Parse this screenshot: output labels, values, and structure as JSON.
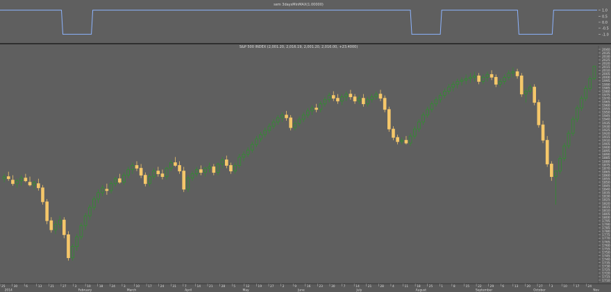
{
  "colors": {
    "background": "#5f5f5f",
    "up_candle_border": "#2f8f2f",
    "up_candle_fill": "#5f5f5f",
    "down_candle": "#f5c76a",
    "ind_line": "#8db4ff",
    "separator": "#1f1f1f",
    "axis_text": "#dcdcdc"
  },
  "chart_data": [
    {
      "type": "line",
      "title": "sem 3daysMinMAX(1.00000)",
      "ylim": [
        -1.5,
        1.5
      ],
      "y_ticks": [
        "1.0",
        "0.5",
        "0.0",
        "-0.5",
        "-1.0"
      ],
      "y_tick_values": [
        1.0,
        0.5,
        0.0,
        -0.5,
        -1.0
      ],
      "segments": [
        {
          "from": 0,
          "to": 0.105,
          "value": 1
        },
        {
          "from": 0.105,
          "to": 0.155,
          "value": -1
        },
        {
          "from": 0.155,
          "to": 0.688,
          "value": 1
        },
        {
          "from": 0.688,
          "to": 0.738,
          "value": -1
        },
        {
          "from": 0.738,
          "to": 0.867,
          "value": 1
        },
        {
          "from": 0.867,
          "to": 0.925,
          "value": -1
        },
        {
          "from": 0.925,
          "to": 1.0,
          "value": 1
        },
        {
          "from": 0.963,
          "to": 1.0,
          "value": -1
        }
      ]
    },
    {
      "type": "candlestick",
      "title": "S&P 500 INDEX (2,001.20, 2,016.19, 2,001.20, 2,016.00, +23.4000)",
      "ylim": [
        1705,
        2045
      ],
      "y_ticks": [
        "2040",
        "2035",
        "2030",
        "2025",
        "2020",
        "2015",
        "2010",
        "2005",
        "2000",
        "1995",
        "1990",
        "1985",
        "1980",
        "1975",
        "1970",
        "1965",
        "1960",
        "1955",
        "1950",
        "1945",
        "1940",
        "1935",
        "1930",
        "1925",
        "1920",
        "1915",
        "1910",
        "1905",
        "1900",
        "1895",
        "1890",
        "1885",
        "1880",
        "1875",
        "1870",
        "1865",
        "1860",
        "1855",
        "1850",
        "1845",
        "1840",
        "1835",
        "1830",
        "1825",
        "1820",
        "1815",
        "1810",
        "1805",
        "1800",
        "1795",
        "1790",
        "1785",
        "1780",
        "1775",
        "1770",
        "1765",
        "1760",
        "1755",
        "1750",
        "1745",
        "1740",
        "1735",
        "1730",
        "1725",
        "1720",
        "1715",
        "1710"
      ],
      "x_ticks": [
        "25",
        "30",
        "6",
        "13",
        "21",
        "27",
        "3",
        "10",
        "18",
        "24",
        "3",
        "10",
        "17",
        "24",
        "31",
        "7",
        "14",
        "21",
        "28",
        "5",
        "12",
        "19",
        "27",
        "2",
        "9",
        "16",
        "23",
        "30",
        "7",
        "14",
        "21",
        "28",
        "4",
        "11",
        "18",
        "25",
        "1",
        "8",
        "15",
        "22",
        "29",
        "6",
        "13",
        "20",
        "27",
        "3",
        "10",
        "17",
        "24"
      ],
      "month_labels": [
        {
          "label": "2014",
          "slot": 0.7
        },
        {
          "label": "February",
          "slot": 11.9
        },
        {
          "label": "March",
          "slot": 19.3
        },
        {
          "label": "April",
          "slot": 28.1
        },
        {
          "label": "May",
          "slot": 36.9
        },
        {
          "label": "June",
          "slot": 45.3
        },
        {
          "label": "July",
          "slot": 54.2
        },
        {
          "label": "August",
          "slot": 63.2
        },
        {
          "label": "September",
          "slot": 72.3
        },
        {
          "label": "October",
          "slot": 81.1
        },
        {
          "label": "Nov",
          "slot": 90.2
        }
      ],
      "ohlc": [
        [
          1855,
          1862,
          1850,
          1858
        ],
        [
          1858,
          1865,
          1852,
          1855
        ],
        [
          1853,
          1860,
          1845,
          1848
        ],
        [
          1848,
          1855,
          1842,
          1852
        ],
        [
          1852,
          1860,
          1845,
          1856
        ],
        [
          1856,
          1862,
          1850,
          1852
        ],
        [
          1850,
          1858,
          1844,
          1846
        ],
        [
          1846,
          1852,
          1840,
          1850
        ],
        [
          1848,
          1855,
          1838,
          1842
        ],
        [
          1842,
          1846,
          1818,
          1822
        ],
        [
          1822,
          1826,
          1790,
          1795
        ],
        [
          1795,
          1800,
          1778,
          1782
        ],
        [
          1782,
          1795,
          1776,
          1790
        ],
        [
          1790,
          1802,
          1784,
          1796
        ],
        [
          1796,
          1800,
          1770,
          1775
        ],
        [
          1775,
          1780,
          1738,
          1742
        ],
        [
          1742,
          1762,
          1738,
          1758
        ],
        [
          1758,
          1776,
          1752,
          1772
        ],
        [
          1772,
          1792,
          1768,
          1788
        ],
        [
          1788,
          1806,
          1782,
          1802
        ],
        [
          1802,
          1818,
          1796,
          1814
        ],
        [
          1814,
          1830,
          1810,
          1826
        ],
        [
          1826,
          1840,
          1820,
          1835
        ],
        [
          1835,
          1846,
          1830,
          1842
        ],
        [
          1840,
          1848,
          1832,
          1838
        ],
        [
          1838,
          1852,
          1834,
          1848
        ],
        [
          1848,
          1858,
          1844,
          1855
        ],
        [
          1855,
          1862,
          1848,
          1850
        ],
        [
          1850,
          1864,
          1846,
          1860
        ],
        [
          1860,
          1872,
          1856,
          1868
        ],
        [
          1868,
          1878,
          1862,
          1874
        ],
        [
          1874,
          1880,
          1866,
          1870
        ],
        [
          1870,
          1876,
          1856,
          1860
        ],
        [
          1860,
          1864,
          1844,
          1848
        ],
        [
          1848,
          1862,
          1844,
          1858
        ],
        [
          1858,
          1870,
          1854,
          1866
        ],
        [
          1866,
          1872,
          1858,
          1862
        ],
        [
          1862,
          1868,
          1854,
          1858
        ],
        [
          1858,
          1872,
          1854,
          1870
        ],
        [
          1870,
          1882,
          1866,
          1878
        ],
        [
          1878,
          1886,
          1872,
          1874
        ],
        [
          1874,
          1880,
          1862,
          1866
        ],
        [
          1866,
          1872,
          1836,
          1840
        ],
        [
          1840,
          1860,
          1836,
          1856
        ],
        [
          1856,
          1866,
          1852,
          1862
        ],
        [
          1862,
          1872,
          1858,
          1868
        ],
        [
          1868,
          1874,
          1860,
          1864
        ],
        [
          1864,
          1872,
          1858,
          1870
        ],
        [
          1870,
          1878,
          1864,
          1872
        ],
        [
          1872,
          1876,
          1860,
          1864
        ],
        [
          1864,
          1878,
          1860,
          1876
        ],
        [
          1876,
          1886,
          1870,
          1882
        ],
        [
          1882,
          1888,
          1870,
          1874
        ],
        [
          1874,
          1878,
          1862,
          1866
        ],
        [
          1866,
          1878,
          1862,
          1874
        ],
        [
          1874,
          1890,
          1870,
          1886
        ],
        [
          1886,
          1894,
          1880,
          1890
        ],
        [
          1890,
          1900,
          1886,
          1896
        ],
        [
          1896,
          1908,
          1892,
          1904
        ],
        [
          1904,
          1916,
          1900,
          1912
        ],
        [
          1912,
          1922,
          1908,
          1918
        ],
        [
          1918,
          1928,
          1914,
          1924
        ],
        [
          1924,
          1934,
          1920,
          1930
        ],
        [
          1930,
          1940,
          1926,
          1936
        ],
        [
          1936,
          1946,
          1932,
          1942
        ],
        [
          1942,
          1950,
          1936,
          1946
        ],
        [
          1946,
          1952,
          1938,
          1942
        ],
        [
          1942,
          1946,
          1924,
          1928
        ],
        [
          1928,
          1938,
          1924,
          1934
        ],
        [
          1934,
          1944,
          1930,
          1940
        ],
        [
          1940,
          1950,
          1936,
          1946
        ],
        [
          1946,
          1956,
          1942,
          1952
        ],
        [
          1952,
          1960,
          1946,
          1956
        ],
        [
          1956,
          1962,
          1950,
          1954
        ],
        [
          1954,
          1966,
          1950,
          1962
        ],
        [
          1962,
          1972,
          1958,
          1968
        ],
        [
          1968,
          1978,
          1964,
          1974
        ],
        [
          1974,
          1980,
          1966,
          1970
        ],
        [
          1970,
          1976,
          1962,
          1966
        ],
        [
          1966,
          1976,
          1960,
          1972
        ],
        [
          1972,
          1980,
          1966,
          1976
        ],
        [
          1976,
          1982,
          1968,
          1972
        ],
        [
          1972,
          1976,
          1962,
          1966
        ],
        [
          1966,
          1974,
          1962,
          1970
        ],
        [
          1970,
          1976,
          1958,
          1962
        ],
        [
          1962,
          1972,
          1958,
          1968
        ],
        [
          1968,
          1976,
          1964,
          1972
        ],
        [
          1972,
          1980,
          1968,
          1976
        ],
        [
          1976,
          1982,
          1966,
          1970
        ],
        [
          1970,
          1974,
          1950,
          1954
        ],
        [
          1954,
          1958,
          1922,
          1926
        ],
        [
          1926,
          1930,
          1910,
          1914
        ],
        [
          1914,
          1918,
          1904,
          1908
        ],
        [
          1908,
          1914,
          1904,
          1910
        ],
        [
          1910,
          1916,
          1904,
          1906
        ],
        [
          1906,
          1920,
          1902,
          1916
        ],
        [
          1916,
          1930,
          1912,
          1926
        ],
        [
          1926,
          1940,
          1922,
          1936
        ],
        [
          1936,
          1950,
          1932,
          1946
        ],
        [
          1946,
          1958,
          1942,
          1954
        ],
        [
          1954,
          1966,
          1950,
          1962
        ],
        [
          1962,
          1972,
          1958,
          1968
        ],
        [
          1968,
          1978,
          1964,
          1974
        ],
        [
          1974,
          1984,
          1970,
          1980
        ],
        [
          1980,
          1990,
          1976,
          1986
        ],
        [
          1986,
          1994,
          1980,
          1990
        ],
        [
          1990,
          1998,
          1984,
          1994
        ],
        [
          1994,
          2000,
          1988,
          1996
        ],
        [
          1996,
          2004,
          1990,
          1998
        ],
        [
          1998,
          2006,
          1992,
          2000
        ],
        [
          2000,
          2008,
          1994,
          2002
        ],
        [
          2002,
          2006,
          1990,
          1994
        ],
        [
          1994,
          2004,
          1990,
          2000
        ],
        [
          2000,
          2008,
          1994,
          2004
        ],
        [
          2004,
          2010,
          1996,
          2000
        ],
        [
          2000,
          2004,
          1986,
          1990
        ],
        [
          1990,
          1998,
          1986,
          1994
        ],
        [
          1994,
          2004,
          1990,
          2000
        ],
        [
          2000,
          2010,
          1996,
          2006
        ],
        [
          2006,
          2014,
          2000,
          2008
        ],
        [
          2008,
          2012,
          1998,
          2002
        ],
        [
          2002,
          2006,
          1972,
          1976
        ],
        [
          1976,
          1984,
          1964,
          1980
        ],
        [
          1980,
          1990,
          1976,
          1986
        ],
        [
          1986,
          1990,
          1960,
          1964
        ],
        [
          1964,
          1968,
          1928,
          1932
        ],
        [
          1932,
          1938,
          1906,
          1910
        ],
        [
          1910,
          1916,
          1872,
          1876
        ],
        [
          1876,
          1880,
          1852,
          1858
        ],
        [
          1858,
          1864,
          1818,
          1866
        ],
        [
          1866,
          1888,
          1862,
          1884
        ],
        [
          1884,
          1906,
          1880,
          1902
        ],
        [
          1902,
          1924,
          1898,
          1920
        ],
        [
          1920,
          1944,
          1916,
          1940
        ],
        [
          1940,
          1960,
          1936,
          1956
        ],
        [
          1956,
          1974,
          1952,
          1970
        ],
        [
          1970,
          1988,
          1966,
          1984
        ],
        [
          1984,
          2002,
          1980,
          1998
        ],
        [
          1998,
          2016,
          1996,
          2016
        ]
      ]
    }
  ]
}
